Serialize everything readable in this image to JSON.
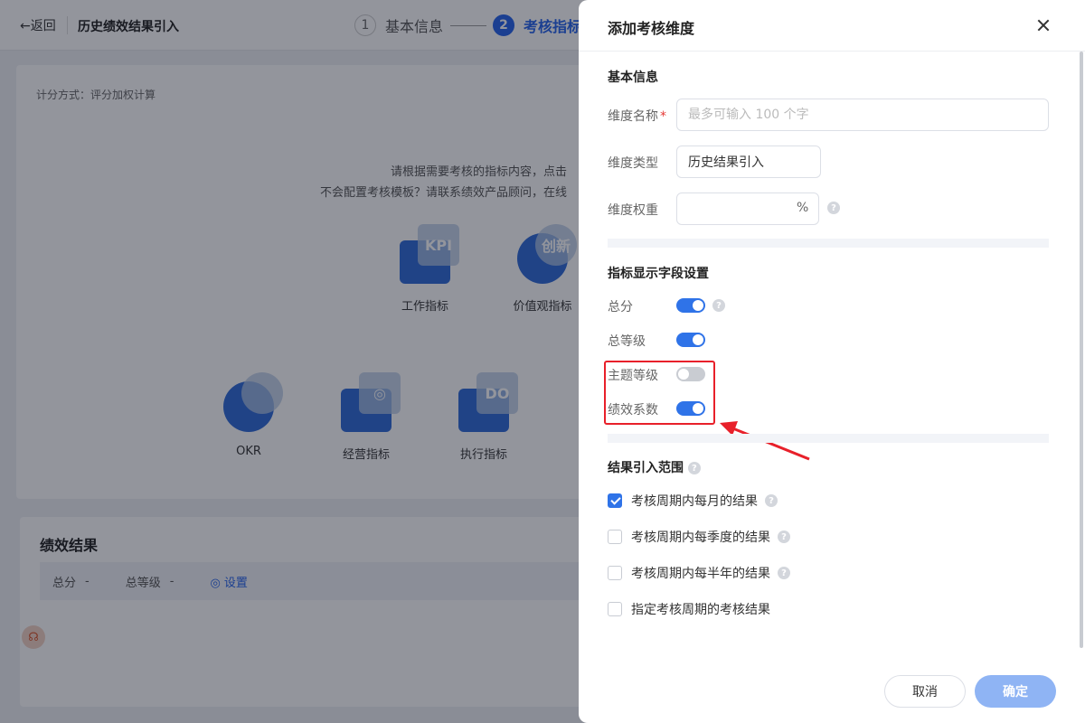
{
  "header": {
    "back_label": "←返回",
    "page_title": "历史绩效结果引入",
    "steps": [
      {
        "num": "1",
        "label": "基本信息"
      },
      {
        "num": "2",
        "label": "考核指标"
      }
    ]
  },
  "main": {
    "score_mode": "计分方式：评分加权计算",
    "hint_line1": "请根据需要考核的指标内容，点击",
    "hint_line2": "不会配置考核模板？请联系绩效产品顾问，在线",
    "tiles": [
      {
        "label": "工作指标",
        "badge": "KPI"
      },
      {
        "label": "价值观指标",
        "badge": "创新"
      },
      {
        "label": "OKR",
        "badge": ""
      },
      {
        "label": "经营指标",
        "badge": "◎"
      },
      {
        "label": "执行指标",
        "badge": "DO"
      }
    ],
    "perf": {
      "title": "绩效结果",
      "total_label": "总分",
      "total_value": "-",
      "grade_label": "总等级",
      "grade_value": "-",
      "settings_label": "◎ 设置"
    }
  },
  "drawer": {
    "title": "添加考核维度",
    "basic_section": "基本信息",
    "name_label": "维度名称",
    "name_required": "*",
    "name_placeholder": "最多可输入 100 个字",
    "type_label": "维度类型",
    "type_value": "历史结果引入",
    "weight_label": "维度权重",
    "weight_unit": "%",
    "fields_section": "指标显示字段设置",
    "toggles": [
      {
        "label": "总分",
        "on": true
      },
      {
        "label": "总等级",
        "on": true
      },
      {
        "label": "主题等级",
        "on": false
      },
      {
        "label": "绩效系数",
        "on": true
      }
    ],
    "range_section": "结果引入范围",
    "ranges": [
      {
        "label": "考核周期内每月的结果",
        "checked": true
      },
      {
        "label": "考核周期内每季度的结果",
        "checked": false
      },
      {
        "label": "考核周期内每半年的结果",
        "checked": false
      },
      {
        "label": "指定考核周期的考核结果",
        "checked": false
      }
    ],
    "cancel_label": "取消",
    "ok_label": "确定",
    "help_mark": "?"
  },
  "colors": {
    "primary": "#2f73e8",
    "annotation": "#e8202a"
  }
}
